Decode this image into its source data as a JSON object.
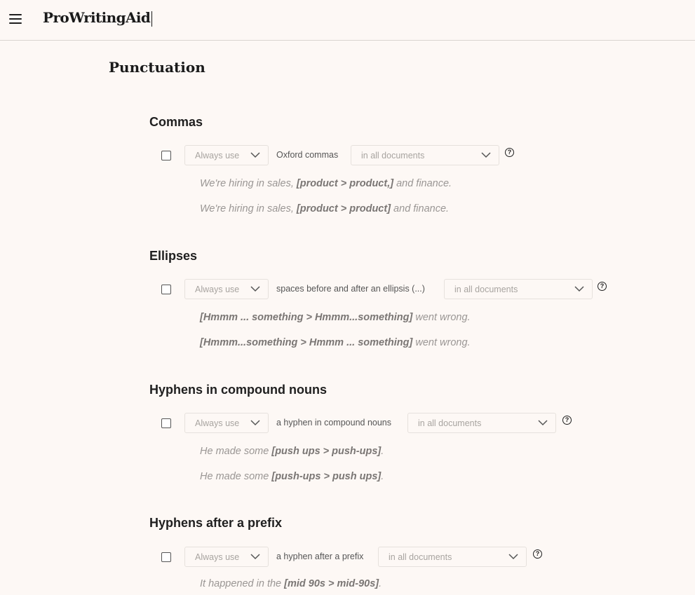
{
  "app": {
    "logo": "ProWritingAid"
  },
  "page": {
    "title": "Punctuation"
  },
  "sections": [
    {
      "title": "Commas",
      "mode": "Always use",
      "rule": "Oxford commas",
      "scope": "in all documents",
      "examples": [
        {
          "pre": "We're hiring in sales, ",
          "bold": "[product > product,]",
          "post": " and finance."
        },
        {
          "pre": "We're hiring in sales, ",
          "bold": "[product > product]",
          "post": " and finance."
        }
      ]
    },
    {
      "title": "Ellipses",
      "mode": "Always use",
      "rule": "spaces before and after an ellipsis (...)",
      "scope": "in all documents",
      "examples": [
        {
          "pre": "",
          "bold": "[Hmmm ... something > Hmmm...something]",
          "post": " went wrong."
        },
        {
          "pre": "",
          "bold": "[Hmmm...something > Hmmm ... something]",
          "post": " went wrong."
        }
      ]
    },
    {
      "title": "Hyphens in compound nouns",
      "mode": "Always use",
      "rule": "a hyphen in compound nouns",
      "scope": "in all documents",
      "examples": [
        {
          "pre": "He made some ",
          "bold": "[push ups > push-ups]",
          "post": "."
        },
        {
          "pre": "He made some ",
          "bold": "[push-ups > push ups]",
          "post": "."
        }
      ]
    },
    {
      "title": "Hyphens after a prefix",
      "mode": "Always use",
      "rule": "a hyphen after a prefix",
      "scope": "in all documents",
      "examples": [
        {
          "pre": "It happened in the ",
          "bold": "[mid 90s > mid-90s]",
          "post": "."
        }
      ]
    }
  ]
}
